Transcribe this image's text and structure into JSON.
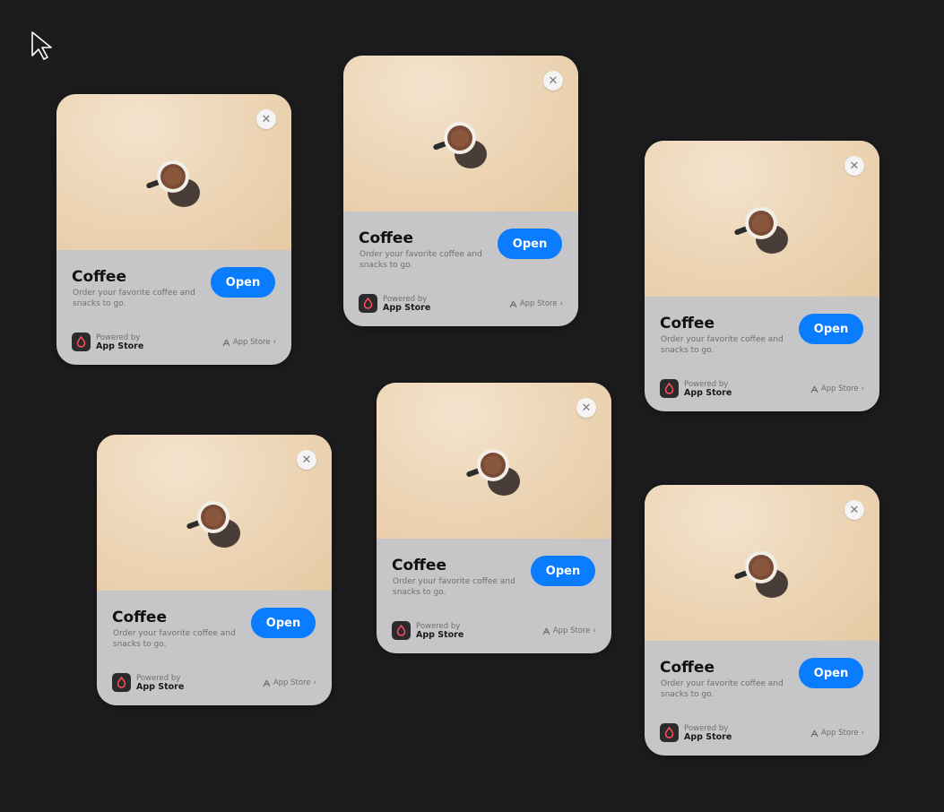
{
  "clip": {
    "title": "Coffee",
    "description": "Order your favorite coffee and snacks to go.",
    "open_label": "Open",
    "close_glyph": "✕",
    "powered_by": "Powered by",
    "app_store": "App Store",
    "store_link": "App Store",
    "chevron": "›",
    "accent_color": "#0a7cff",
    "icons": [
      "close-icon",
      "coffee-cup-image",
      "app-logo-icon",
      "app-store-icon",
      "chevron-right-icon"
    ]
  }
}
